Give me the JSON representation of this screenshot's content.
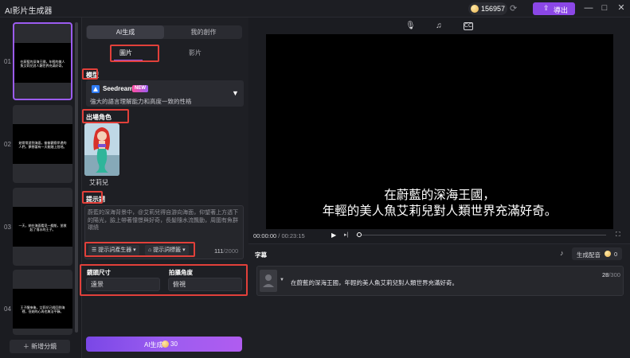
{
  "window": {
    "title": "AI影片生成器"
  },
  "header": {
    "credits": "156957",
    "export_label": "導出"
  },
  "scenes": [
    {
      "num": "01",
      "caption": "在蔚藍的深海王國，年輕的美人魚艾莉兒對人類世界充滿好奇。"
    },
    {
      "num": "02",
      "caption": "她常常游到海面，偷偷觀察岸邊的人們，夢想著有一天能踏上陸地。"
    },
    {
      "num": "03",
      "caption": "一天，她在海面看見一艘船，並救起了落水的王子。"
    },
    {
      "num": "04",
      "caption": "王子醒來後，艾莉兒已經回到海裡，但她的心再也無法平靜。"
    }
  ],
  "add_scene_label": "新增分鏡",
  "panel": {
    "tabs": [
      "AI生成",
      "我的創作"
    ],
    "sub_tabs": [
      "圖片",
      "影片"
    ],
    "model_label": "模型",
    "model_name": "Seedream 4.0",
    "model_badge": "NEW",
    "model_desc": "強大的語言理解能力和高度一致的性格",
    "character_label": "出場角色",
    "character_name": "艾莉兒",
    "prompt_label": "提示詞",
    "prompt_text": "蔚藍的深海背景中，@艾莉兒得自游向海面，仰望著上方透下的陽光，臉上帶著憧憬與好奇，長髮隨水流飄動，周圍有魚群環繞",
    "prompt_generator_label": "提示詞產生器",
    "prompt_tags_label": "提示詞標籤",
    "prompt_count": "111",
    "prompt_max": "/2000",
    "shot_size_label": "鏡頭尺寸",
    "shot_size_value": "遠景",
    "angle_label": "拍攝角度",
    "angle_value": "俯視",
    "generate_label": "AI生成",
    "generate_cost": "30"
  },
  "player": {
    "caption_line1": "在蔚藍的深海王國，",
    "caption_line2": "年輕的美人魚艾莉兒對人類世界充滿好奇。",
    "current_time": "00:00:00",
    "total_time": "/ 00:23:15",
    "progress": 0.0
  },
  "subtitles": {
    "title": "字幕",
    "dub_label": "生成配音",
    "dub_cost": "0",
    "row_text": "在蔚藍的深海王國，年輕的美人魚艾莉兒對人類世界充滿好奇。",
    "row_count": "28",
    "row_max": "/300"
  },
  "colors": {
    "accent": "#9b5cf0",
    "highlight_box": "#e2403a",
    "background": "#17181c"
  }
}
